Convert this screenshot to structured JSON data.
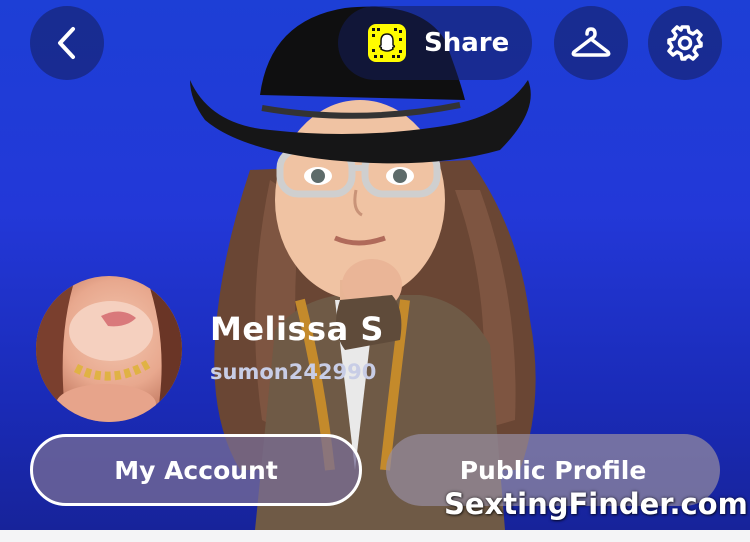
{
  "header": {
    "share_label": "Share",
    "icons": [
      "chevron-left-icon",
      "snapcode-icon",
      "hanger-icon",
      "gear-icon"
    ]
  },
  "profile": {
    "display_name": "Melissa S",
    "username": "sumon242990"
  },
  "actions": {
    "my_account_label": "My Account",
    "public_profile_label": "Public Profile"
  },
  "watermark": "SextingFinder.com",
  "colors": {
    "background_blue": "#2338d8",
    "snapcode_yellow": "#fffc00",
    "text_white": "#ffffff"
  }
}
